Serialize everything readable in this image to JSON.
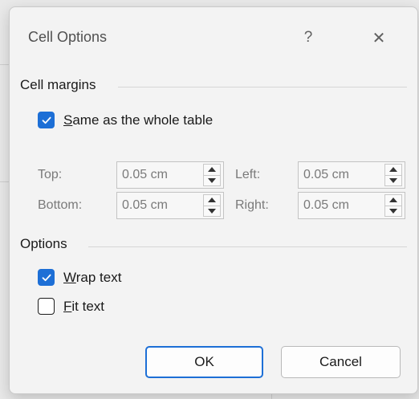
{
  "dialog": {
    "title": "Cell Options",
    "help_label": "?",
    "close_label": "✕"
  },
  "cell_margins": {
    "heading": "Cell margins",
    "same_as_table": {
      "accel": "S",
      "rest": "ame as the whole table",
      "checked": true
    },
    "top": {
      "label": "Top:",
      "value": "0.05 cm"
    },
    "left": {
      "label": "Left:",
      "value": "0.05 cm"
    },
    "bottom": {
      "label": "Bottom:",
      "value": "0.05 cm"
    },
    "right": {
      "label": "Right:",
      "value": "0.05 cm"
    }
  },
  "options": {
    "heading": "Options",
    "wrap_text": {
      "accel": "W",
      "rest": "rap text",
      "checked": true
    },
    "fit_text": {
      "accel": "F",
      "rest": "it text",
      "checked": false
    }
  },
  "buttons": {
    "ok": "OK",
    "cancel": "Cancel"
  },
  "colors": {
    "accent": "#1d6fd6"
  }
}
